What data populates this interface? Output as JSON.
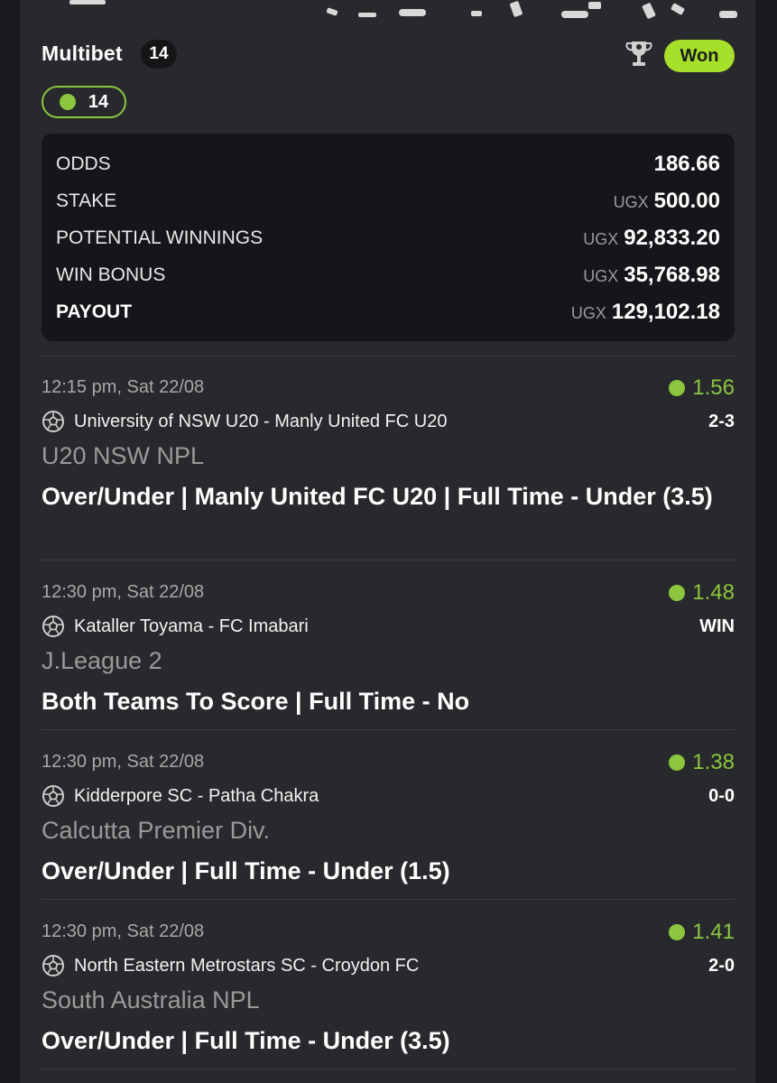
{
  "header": {
    "title": "Multibet",
    "selection_count": "14",
    "status": "Won"
  },
  "won_pill": {
    "count": "14"
  },
  "summary": [
    {
      "label": "ODDS",
      "currency": "",
      "value": "186.66",
      "bold": false
    },
    {
      "label": "STAKE",
      "currency": "UGX",
      "value": "500.00",
      "bold": false
    },
    {
      "label": "POTENTIAL WINNINGS",
      "currency": "UGX",
      "value": "92,833.20",
      "bold": false
    },
    {
      "label": "WIN BONUS",
      "currency": "UGX",
      "value": "35,768.98",
      "bold": false
    },
    {
      "label": "PAYOUT",
      "currency": "UGX",
      "value": "129,102.18",
      "bold": true
    }
  ],
  "selections": [
    {
      "time": "12:15 pm, Sat 22/08",
      "odds": "1.56",
      "match": "University of NSW U20 - Manly United FC U20",
      "result": "2-3",
      "league": "U20 NSW NPL",
      "market": "Over/Under | Manly United FC U20 | Full Time - Under (3.5)"
    },
    {
      "time": "12:30 pm, Sat 22/08",
      "odds": "1.48",
      "match": "Kataller Toyama - FC Imabari",
      "result": "WIN",
      "league": "J.League 2",
      "market": "Both Teams To Score | Full Time - No"
    },
    {
      "time": "12:30 pm, Sat 22/08",
      "odds": "1.38",
      "match": "Kidderpore SC - Patha Chakra",
      "result": "0-0",
      "league": "Calcutta Premier Div.",
      "market": "Over/Under | Full Time - Under (1.5)"
    },
    {
      "time": "12:30 pm, Sat 22/08",
      "odds": "1.41",
      "match": "North Eastern Metrostars SC - Croydon FC",
      "result": "2-0",
      "league": "South Australia NPL",
      "market": "Over/Under | Full Time - Under (3.5)"
    }
  ],
  "colors": {
    "accent": "#8cc63f",
    "won_badge": "#a6e02a",
    "card_bg": "#27292c",
    "summary_bg": "#15161a"
  }
}
